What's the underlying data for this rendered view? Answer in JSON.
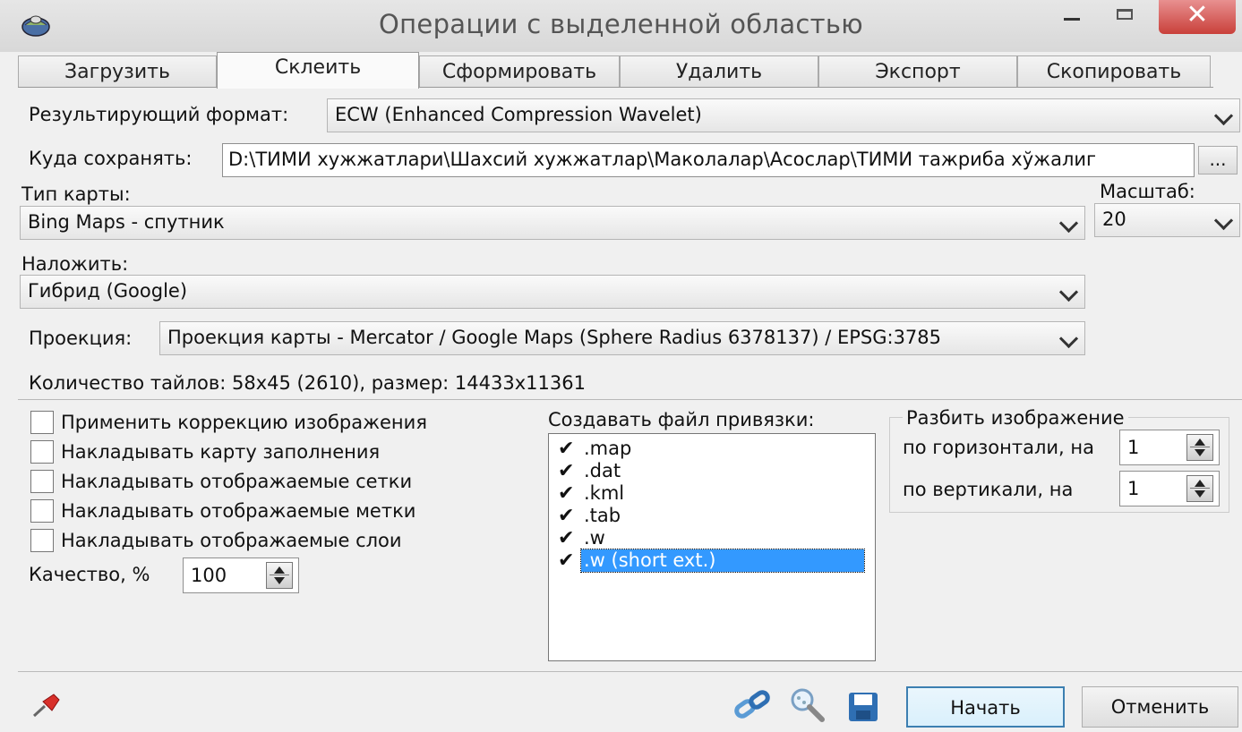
{
  "window": {
    "title": "Операции с выделенной областью",
    "close_glyph": "✕"
  },
  "tabs": [
    {
      "label": "Загрузить",
      "active": false
    },
    {
      "label": "Склеить",
      "active": true
    },
    {
      "label": "Сформировать",
      "active": false
    },
    {
      "label": "Удалить",
      "active": false
    },
    {
      "label": "Экспорт",
      "active": false
    },
    {
      "label": "Скопировать",
      "active": false
    }
  ],
  "form": {
    "result_format_label": "Результирующий формат:",
    "result_format_value": "ECW (Enhanced Compression Wavelet)",
    "save_to_label": "Куда сохранять:",
    "save_to_value": "D:\\ТИМИ хужжатлари\\Шахсий хужжатлар\\Маколалар\\Асослар\\ТИМИ тажриба хўжалиг",
    "browse_label": "...",
    "map_type_label": "Тип карты:",
    "map_type_value": "Bing Maps - спутник",
    "scale_label": "Масштаб:",
    "scale_value": "20",
    "overlay_label": "Наложить:",
    "overlay_value": "Гибрид (Google)",
    "projection_label": "Проекция:",
    "projection_value": "Проекция карты - Mercator / Google Maps (Sphere Radius 6378137) / EPSG:3785",
    "tiles_info": "Количество тайлов: 58x45 (2610), размер: 14433x11361"
  },
  "options": [
    {
      "label": "Применить коррекцию изображения",
      "checked": false
    },
    {
      "label": "Накладывать карту заполнения",
      "checked": false
    },
    {
      "label": "Накладывать отображаемые сетки",
      "checked": false
    },
    {
      "label": "Накладывать отображаемые метки",
      "checked": false
    },
    {
      "label": "Накладывать отображаемые слои",
      "checked": false
    }
  ],
  "quality": {
    "label": "Качество, %",
    "value": "100"
  },
  "georef": {
    "label": "Создавать файл привязки:",
    "check_glyph": "✔",
    "items": [
      {
        "label": ".map",
        "checked": true
      },
      {
        "label": ".dat",
        "checked": true
      },
      {
        "label": ".kml",
        "checked": true
      },
      {
        "label": ".tab",
        "checked": true
      },
      {
        "label": ".w",
        "checked": true
      },
      {
        "label": ".w (short ext.)",
        "checked": true,
        "selected": true
      }
    ]
  },
  "split": {
    "title": "Разбить изображение",
    "horizontal_label": "по горизонтали, на",
    "horizontal_value": "1",
    "vertical_label": "по вертикали, на",
    "vertical_value": "1"
  },
  "buttons": {
    "start": "Начать",
    "cancel": "Отменить"
  },
  "colors": {
    "selection": "#3399ff",
    "close": "#c9403a",
    "default_border": "#3c7fb1"
  }
}
